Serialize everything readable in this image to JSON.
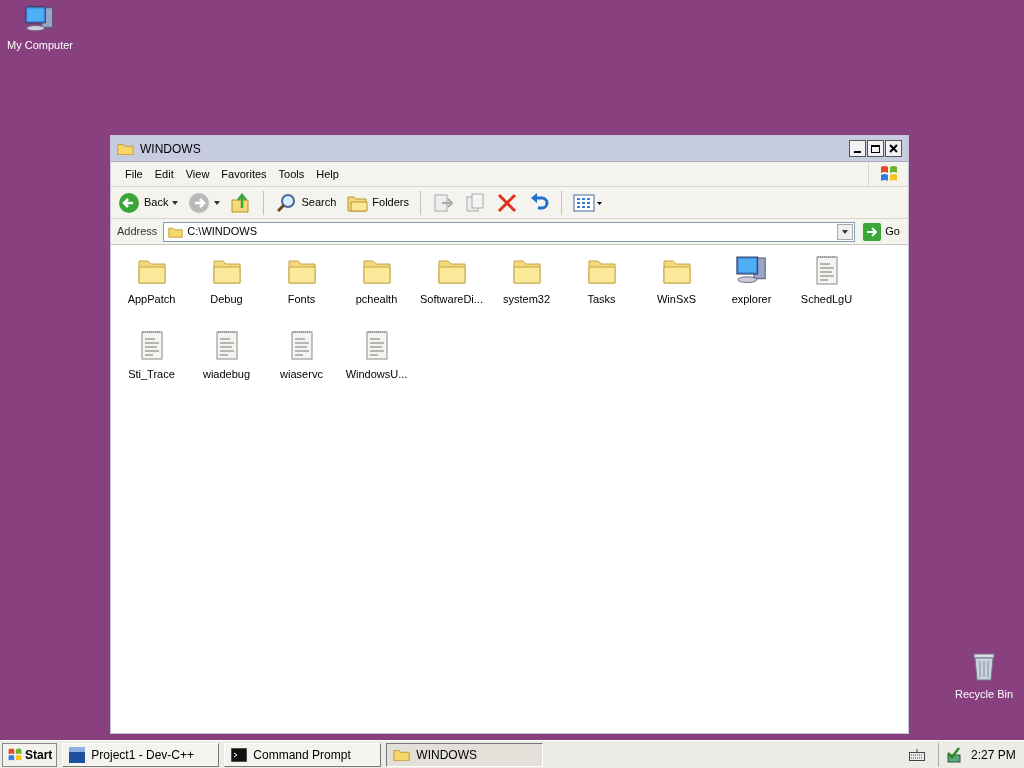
{
  "desktop_icons": [
    {
      "label": "My Computer",
      "kind": "computer"
    },
    {
      "label": "Recycle Bin",
      "kind": "bin"
    }
  ],
  "window": {
    "title": "WINDOWS",
    "menu": [
      "File",
      "Edit",
      "View",
      "Favorites",
      "Tools",
      "Help"
    ],
    "toolbar": [
      {
        "kind": "back",
        "label": "Back"
      },
      {
        "kind": "forward"
      },
      {
        "kind": "up"
      },
      {
        "kind": "search",
        "label": "Search"
      },
      {
        "kind": "folders",
        "label": "Folders"
      },
      {
        "kind": "move"
      },
      {
        "kind": "copy"
      },
      {
        "kind": "delete"
      },
      {
        "kind": "undo"
      },
      {
        "kind": "views"
      }
    ],
    "address": {
      "label": "Address",
      "value": "C:\\WINDOWS",
      "go": "Go"
    },
    "items": [
      {
        "name": "AppPatch",
        "kind": "folder"
      },
      {
        "name": "Debug",
        "kind": "folder"
      },
      {
        "name": "Fonts",
        "kind": "folder"
      },
      {
        "name": "pchealth",
        "kind": "folder"
      },
      {
        "name": "SoftwareDi...",
        "kind": "folder"
      },
      {
        "name": "system32",
        "kind": "folder"
      },
      {
        "name": "Tasks",
        "kind": "folder"
      },
      {
        "name": "WinSxS",
        "kind": "folder"
      },
      {
        "name": "explorer",
        "kind": "app"
      },
      {
        "name": "SchedLgU",
        "kind": "file"
      },
      {
        "name": "Sti_Trace",
        "kind": "file"
      },
      {
        "name": "wiadebug",
        "kind": "file"
      },
      {
        "name": "wiaservc",
        "kind": "file"
      },
      {
        "name": "WindowsU...",
        "kind": "file"
      }
    ]
  },
  "taskbar": {
    "start": "Start",
    "tasks": [
      {
        "label": "Project1 - Dev-C++",
        "kind": "devcpp",
        "selected": false
      },
      {
        "label": "Command Prompt",
        "kind": "cmd",
        "selected": false
      },
      {
        "label": "WINDOWS",
        "kind": "folder",
        "selected": true
      }
    ],
    "clock": "2:27 PM"
  }
}
